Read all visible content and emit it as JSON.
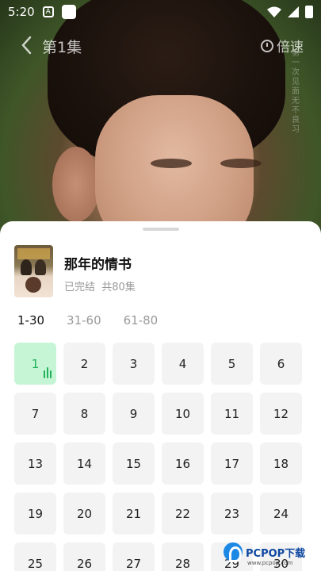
{
  "status_bar": {
    "time": "5:20",
    "icons": [
      "font-a-icon",
      "square-icon",
      "wifi-icon",
      "signal-icon",
      "battery-icon"
    ]
  },
  "player": {
    "episode_title": "第1集",
    "speed_label": "倍速",
    "subtitle_vertical": "第一次见面 无不良习"
  },
  "drama": {
    "title": "那年的情书",
    "status": "已完结",
    "episode_count": "共80集"
  },
  "ranges": [
    {
      "label": "1-30",
      "active": true
    },
    {
      "label": "31-60",
      "active": false
    },
    {
      "label": "61-80",
      "active": false
    }
  ],
  "episodes": [
    "1",
    "2",
    "3",
    "4",
    "5",
    "6",
    "7",
    "8",
    "9",
    "10",
    "11",
    "12",
    "13",
    "14",
    "15",
    "16",
    "17",
    "18",
    "19",
    "20",
    "21",
    "22",
    "23",
    "24",
    "25",
    "26",
    "27",
    "28",
    "29",
    "30"
  ],
  "current_episode": "1",
  "watermark": {
    "brand": "PCPOP下载",
    "sub": "www.pcpop.com"
  },
  "colors": {
    "accent": "#1fb25a",
    "current_bg": "#c6f5d6",
    "tile_bg": "#f3f3f3"
  }
}
